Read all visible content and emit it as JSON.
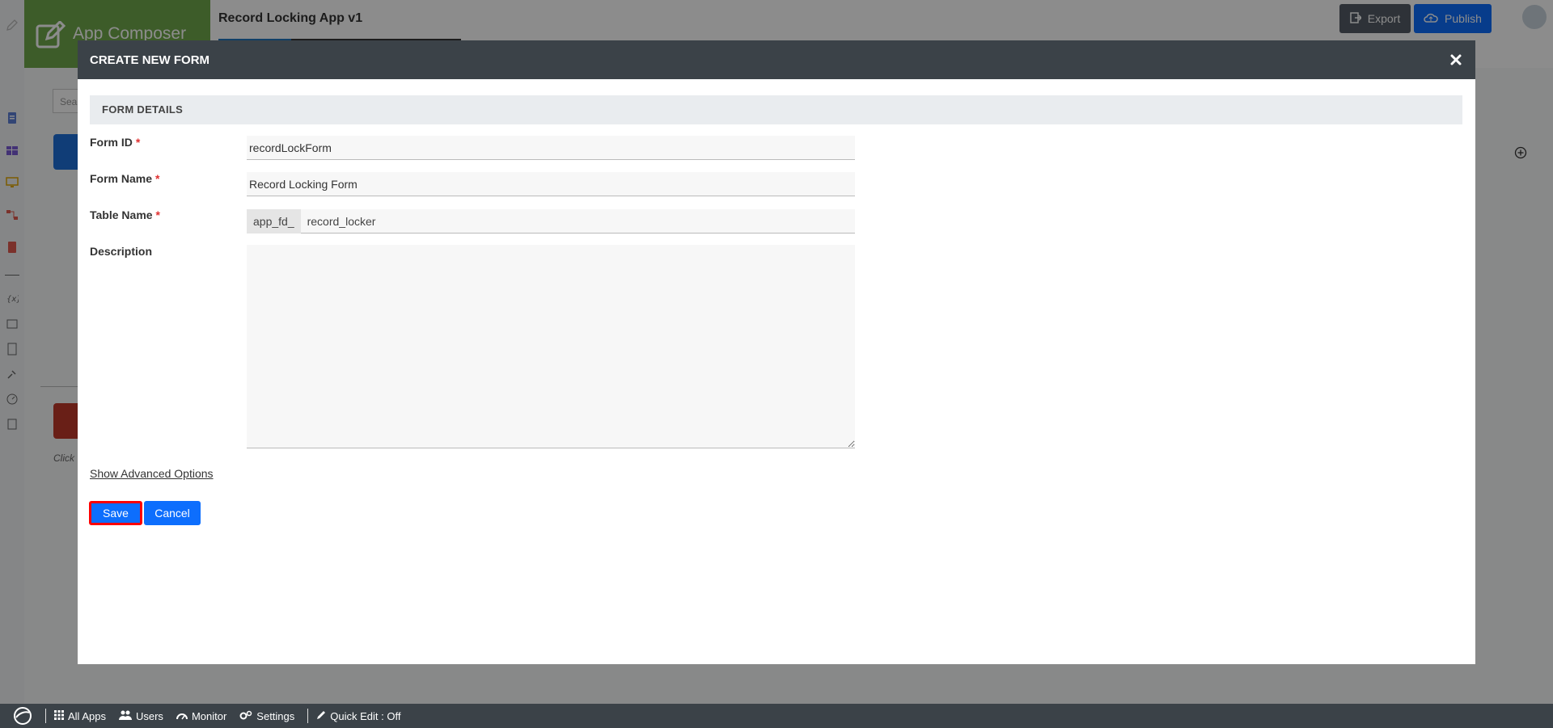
{
  "background": {
    "brand_title": "App Composer",
    "app_title": "Record Locking App v1",
    "export_label": "Export",
    "publish_label": "Publish",
    "search_placeholder": "Sear",
    "click_hint": "Click"
  },
  "footer": {
    "items": [
      "All Apps",
      "Users",
      "Monitor",
      "Settings"
    ],
    "quick_edit": "Quick Edit : Off"
  },
  "modal": {
    "title": "CREATE NEW FORM",
    "section": "FORM DETAILS",
    "required_mark": "*",
    "form_id": {
      "label": "Form ID",
      "value": "recordLockForm"
    },
    "form_name": {
      "label": "Form Name",
      "value": "Record Locking Form"
    },
    "table_name": {
      "label": "Table Name",
      "prefix": "app_fd_",
      "value": "record_locker"
    },
    "description": {
      "label": "Description",
      "value": ""
    },
    "advanced_link": "Show Advanced Options",
    "save_label": "Save",
    "cancel_label": "Cancel"
  },
  "colors": {
    "header_dark": "#3b4248",
    "primary": "#0d6efd",
    "brand_green": "#6fa84b",
    "highlight": "#ff0000",
    "required": "#e03131"
  }
}
